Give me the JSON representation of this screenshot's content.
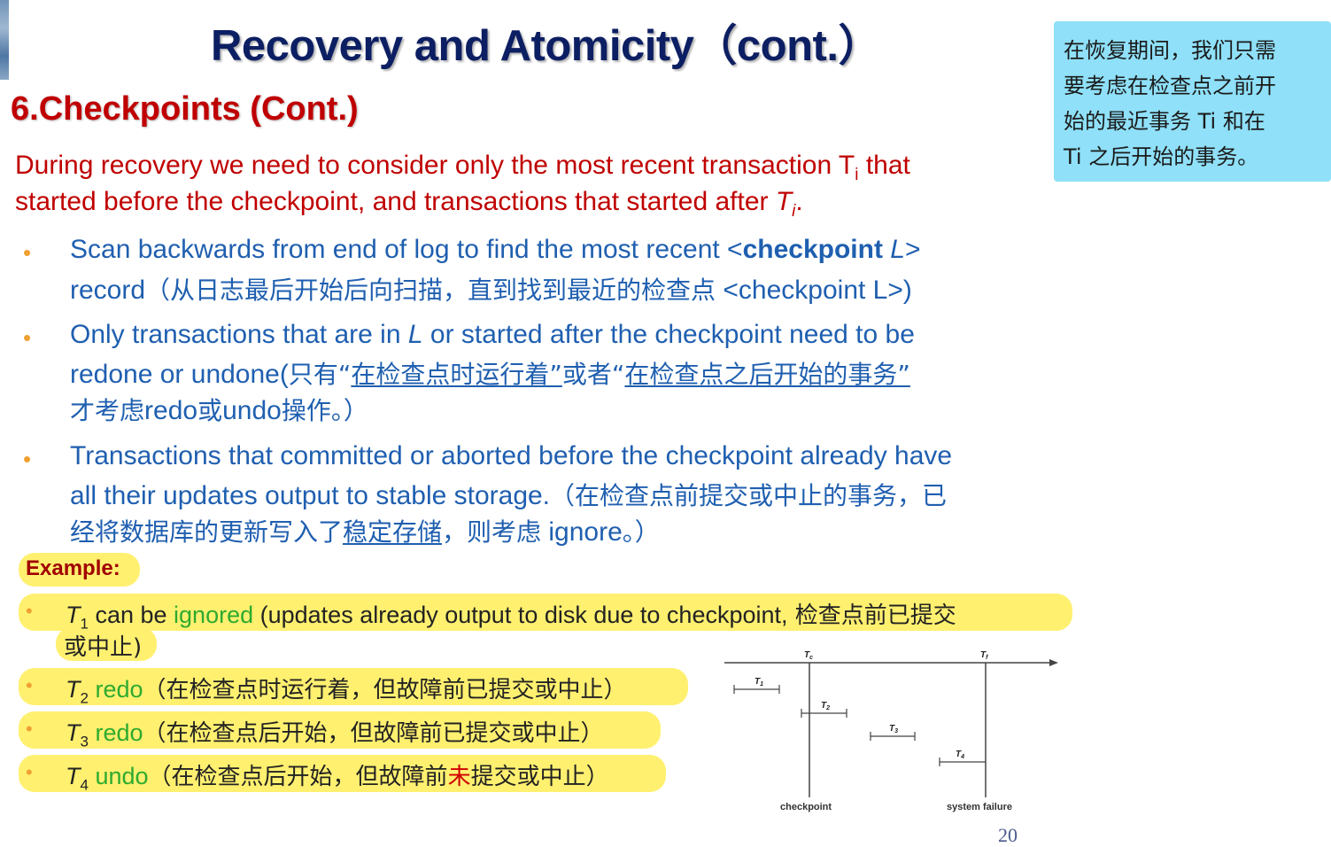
{
  "slide": {
    "title": "Recovery and Atomicity（cont.）",
    "section_heading": "6.Checkpoints (Cont.)",
    "page_number": "20"
  },
  "note": {
    "lines": [
      "在恢复期间，我们只需",
      "要考虑在检查点之前开",
      "始的最近事务 Ti 和在",
      "Ti 之后开始的事务。"
    ],
    "background": "#8fe0f8"
  },
  "intro": {
    "line1_a": "During recovery we need to consider only the most recent transaction T",
    "line1_sub": "i",
    "line1_b": " that",
    "line2_a": "started before the checkpoint, and transactions that started after ",
    "line2_T": "T",
    "line2_sub": "i",
    "line2_b": "."
  },
  "bullets": {
    "b1": {
      "l1_a": "Scan backwards from end of log to find the most recent <",
      "l1_bold": "checkpoint",
      "l1_italic": " L",
      "l1_b": ">",
      "l2_a": "record",
      "l2_cjk": "（从日志最后开始后向扫描，直到找到最近的检查点",
      "l2_b": " <checkpoint L>)"
    },
    "b2": {
      "l1_a": "Only transactions that are in ",
      "l1_italic": "L",
      "l1_b": " or started after the checkpoint need to be",
      "l2_a": "redone or undone(",
      "l2_cjk1": "只有“",
      "l2_u1": "在检查点时运行着”",
      "l2_cjk2": "或者“",
      "l2_u2": "在检查点之后开始的事务”",
      "l3_cjk": "才考虑",
      "l3_a": "redo",
      "l3_cjk2": "或",
      "l3_b": "undo",
      "l3_cjk3": "操作。）"
    },
    "b3": {
      "l1": "Transactions that committed or aborted before the checkpoint already have",
      "l2_a": "all their updates output to stable storage.",
      "l2_cjk": "（在检查点前提交或中止的事务，已",
      "l3_cjk": "经将数据库的更新写入了",
      "l3_u": "稳定存储",
      "l3_cjk2": "，则考虑",
      "l3_a": " ignore",
      "l3_cjk3": "。）"
    }
  },
  "example": {
    "label": "Example:",
    "highlight_color": "#fff070",
    "e1": {
      "T": "T",
      "sub": "1",
      "a": " can be ",
      "green": "ignored",
      "b": " (updates already output to disk due to checkpoint,",
      "cjk": " 检查点前已提交",
      "l2": "或中止)"
    },
    "e2": {
      "T": "T",
      "sub": "2",
      "green": " redo",
      "cjk": "（在检查点时运行着，但故障前已提交或中止）"
    },
    "e3": {
      "T": "T",
      "sub": "3",
      "green": " redo",
      "cjk": "（在检查点后开始，但故障前已提交或中止）"
    },
    "e4": {
      "T": "T",
      "sub": "4",
      "green": " undo",
      "cjk_a": "（在检查点后开始，但故障前",
      "red": "未",
      "cjk_b": "提交或中止）"
    }
  },
  "diagram": {
    "tc_label": "T",
    "tc_sub": "c",
    "tf_label": "T",
    "tf_sub": "f",
    "t1": "T",
    "t1_sub": "1",
    "t2": "T",
    "t2_sub": "2",
    "t3": "T",
    "t3_sub": "3",
    "t4": "T",
    "t4_sub": "4",
    "checkpoint_label": "checkpoint",
    "failure_label": "system failure"
  }
}
